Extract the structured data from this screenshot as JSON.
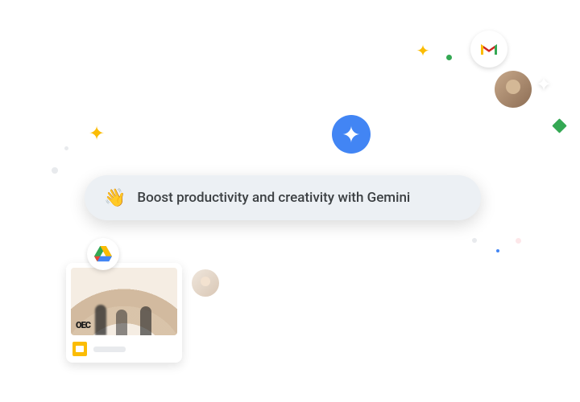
{
  "banner": {
    "emoji": "👋",
    "text": "Boost productivity and creativity with Gemini"
  },
  "thumb": {
    "badge": "OEC"
  },
  "icons": {
    "gmail": "gmail-icon",
    "drive": "drive-icon",
    "slides": "slides-icon",
    "gemini": "gemini-sparkle-icon"
  }
}
